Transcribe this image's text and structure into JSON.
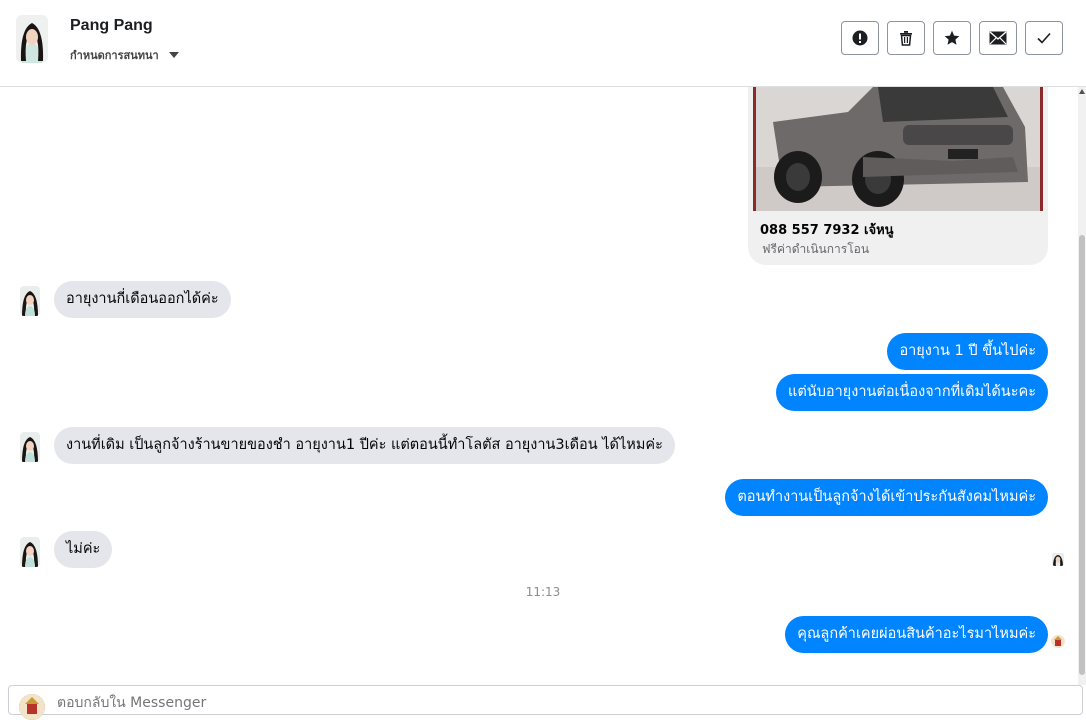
{
  "header": {
    "contact_name": "Pang Pang",
    "status_label": "กำหนดการสนทนา",
    "actions": [
      "spam-icon",
      "trash-icon",
      "star-icon",
      "mail-icon",
      "check-icon"
    ]
  },
  "card": {
    "title": "088 557 7932 เจ้หนู",
    "subtitle": "ฟรีค่าดำเนินการโอน"
  },
  "messages": [
    {
      "side": "in",
      "text": "อายุงานกี่เดือนออกได้ค่ะ"
    },
    {
      "side": "out",
      "text": "อายุงาน 1 ปี ขึ้นไปค่ะ"
    },
    {
      "side": "out",
      "text": "แต่นับอายุงานต่อเนื่องจากที่เดิมได้นะคะ"
    },
    {
      "side": "in",
      "text": "งานที่เดิม เป็นลูกจ้างร้านขายของชำ อายุงาน1 ปีค่ะ แต่ตอนนี้ทำโลตัส อายุงาน3เดือน ได้ไหมค่ะ"
    },
    {
      "side": "out",
      "text": "ตอนทำงานเป็นลูกจ้างได้เข้าประกันสังคมไหมค่ะ"
    },
    {
      "side": "in",
      "text": "ไม่ค่ะ"
    },
    {
      "side": "out",
      "text": "คุณลูกค้าเคยผ่อนสินค้าอะไรมาไหมค่ะ"
    }
  ],
  "timestamp": "11:13",
  "composer": {
    "placeholder": "ตอบกลับใน Messenger"
  },
  "colors": {
    "outgoing": "#0084ff",
    "incoming": "#e4e6eb"
  }
}
